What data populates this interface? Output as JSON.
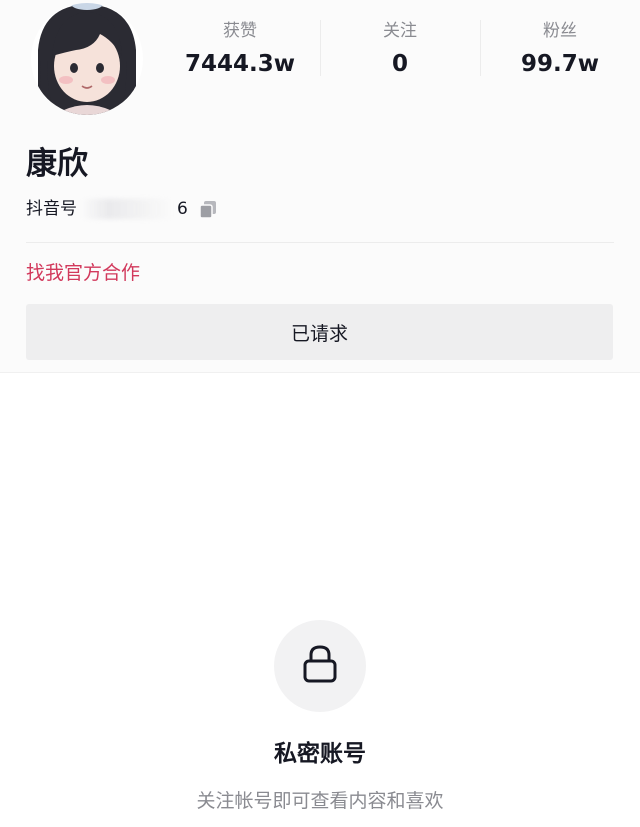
{
  "profile": {
    "name": "康欣",
    "douyin_id_label": "抖音号",
    "douyin_id_visible_tail": "6"
  },
  "stats": [
    {
      "label": "获赞",
      "value": "7444.3w"
    },
    {
      "label": "关注",
      "value": "0"
    },
    {
      "label": "粉丝",
      "value": "99.7w"
    }
  ],
  "actions": {
    "cooperation_link": "找我官方合作",
    "request_button": "已请求"
  },
  "private_notice": {
    "title": "私密账号",
    "description": "关注帐号即可查看内容和喜欢"
  },
  "icons": {
    "copy": "copy-icon",
    "lock": "lock-icon",
    "avatar": "avatar"
  },
  "colors": {
    "accent_link": "#d2395c",
    "button_bg": "#eeeeef",
    "muted_text": "#8a8b91"
  }
}
